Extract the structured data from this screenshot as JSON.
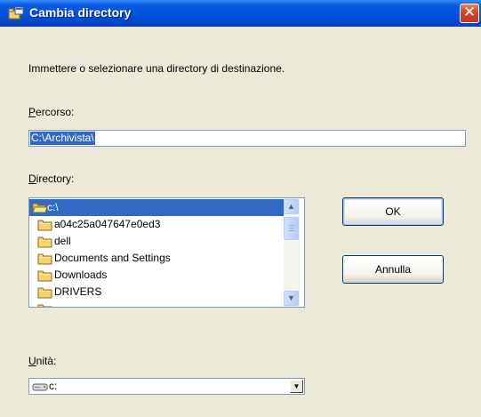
{
  "window": {
    "title": "Cambia directory",
    "close_glyph": "✕"
  },
  "dialog": {
    "instruction": "Immettere o selezionare una directory di destinazione.",
    "path_label_hotkey": "P",
    "path_label_rest": "ercorso:",
    "path_value": "C:\\Archivista\\",
    "directory_label_hotkey": "D",
    "directory_label_rest": "irectory:",
    "directories": [
      {
        "name": "c:\\",
        "selected": true,
        "open": true
      },
      {
        "name": "a04c25a047647e0ed3",
        "selected": false
      },
      {
        "name": "dell",
        "selected": false
      },
      {
        "name": "Documents and Settings",
        "selected": false
      },
      {
        "name": "Downloads",
        "selected": false
      },
      {
        "name": "DRIVERS",
        "selected": false
      }
    ],
    "drive_label_hotkey": "U",
    "drive_label_rest": "nità:",
    "drive_value": "c:"
  },
  "buttons": {
    "ok": "OK",
    "cancel": "Annulla"
  },
  "scroll": {
    "up_glyph": "▲",
    "down_glyph": "▼"
  },
  "combo": {
    "arrow_glyph": "▼"
  },
  "icons": {
    "app": "folder-window-icon",
    "folder": "folder-icon",
    "open_folder": "open-folder-icon",
    "drive": "hard-drive-icon"
  },
  "colors": {
    "titlebar": "#0054E3",
    "selection": "#316AC5",
    "dialog_bg": "#ECE9D8",
    "folder": "#F5D56B"
  }
}
